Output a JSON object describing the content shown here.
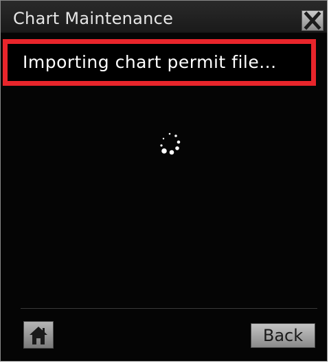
{
  "window": {
    "title": "Chart Maintenance"
  },
  "status": {
    "message": "Importing chart permit file..."
  },
  "footer": {
    "back_label": "Back"
  },
  "icons": {
    "close": "close-icon",
    "spinner": "loading-spinner-icon",
    "home": "home-icon"
  },
  "colors": {
    "highlight_border": "#e8252b",
    "background": "#050505",
    "text": "#ffffff"
  }
}
